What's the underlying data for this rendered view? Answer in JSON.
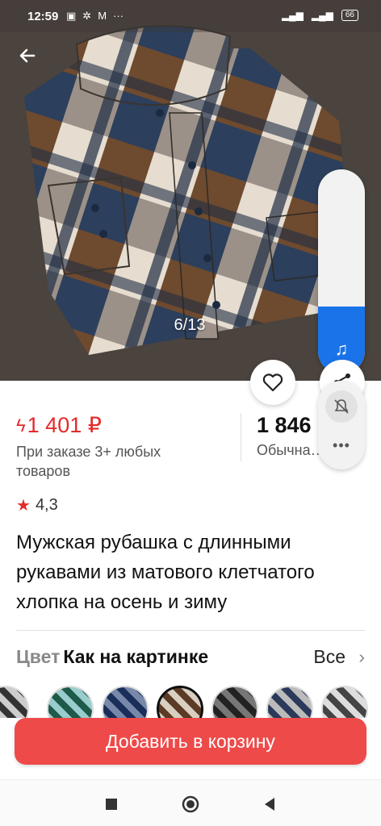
{
  "status_bar": {
    "time": "12:59",
    "icons": [
      "gallery-icon",
      "sync-icon",
      "gmail-icon",
      "more-dots-icon"
    ],
    "battery": "66"
  },
  "gallery": {
    "counter": "6/13"
  },
  "volume_panel": {
    "level_fraction": 0.33
  },
  "price": {
    "promo": "1 401 ₽",
    "promo_note": "При заказе 3+ любых товаров",
    "regular": "1 846",
    "regular_note": "Обычна…"
  },
  "rating": {
    "value": "4,3"
  },
  "product": {
    "title": "Мужская рубашка с длинными рукавами из матового клетчатого хлопка на осень и зиму"
  },
  "color": {
    "label": "Цвет",
    "value": "Как на картинке",
    "all_link": "Все"
  },
  "cart": {
    "button": "Добавить в корзину"
  },
  "colors": {
    "accent": "#e32b2b",
    "cta": "#ee4a4a",
    "volume_fill": "#1a73e8"
  }
}
